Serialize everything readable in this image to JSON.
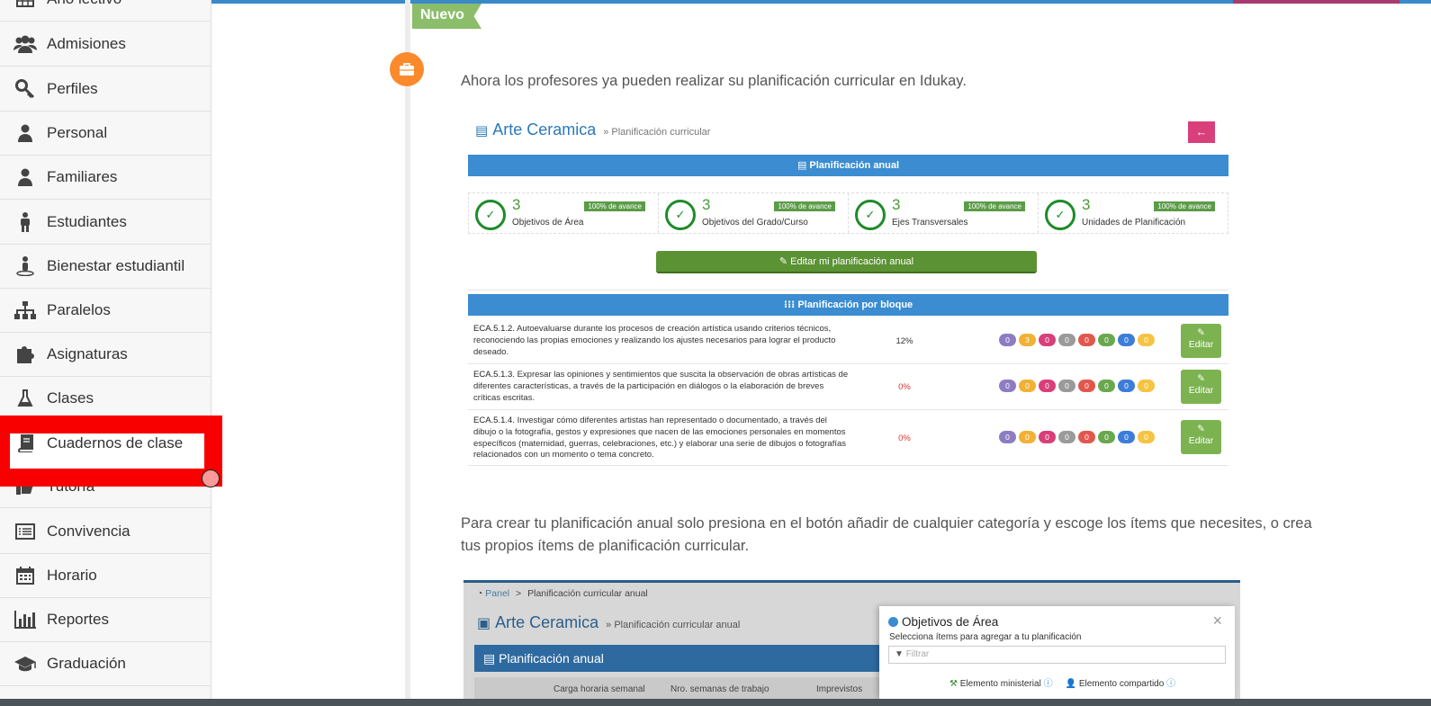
{
  "sidebar": {
    "items": [
      {
        "label": "Año lectivo",
        "icon": "calendar-grid-icon"
      },
      {
        "label": "Admisiones",
        "icon": "users-icon"
      },
      {
        "label": "Perfiles",
        "icon": "key-icon"
      },
      {
        "label": "Personal",
        "icon": "user-icon"
      },
      {
        "label": "Familiares",
        "icon": "user-icon"
      },
      {
        "label": "Estudiantes",
        "icon": "child-icon"
      },
      {
        "label": "Bienestar estudiantil",
        "icon": "person-pin-icon"
      },
      {
        "label": "Paralelos",
        "icon": "sitemap-icon"
      },
      {
        "label": "Asignaturas",
        "icon": "puzzle-icon"
      },
      {
        "label": "Clases",
        "icon": "flask-icon"
      },
      {
        "label": "Cuadernos de clase",
        "icon": "book-icon"
      },
      {
        "label": "Tutoría",
        "icon": "thumbs-up-icon"
      },
      {
        "label": "Convivencia",
        "icon": "list-alt-icon"
      },
      {
        "label": "Horario",
        "icon": "calendar-icon"
      },
      {
        "label": "Reportes",
        "icon": "bar-chart-icon"
      },
      {
        "label": "Graduación",
        "icon": "graduation-cap-icon"
      }
    ]
  },
  "timeline": {
    "tag": "Nuevo",
    "icon": "briefcase-icon",
    "intro": "Ahora los profesores ya pueden realizar su planificación curricular en Idukay.",
    "outro": "Para crear tu planificación anual solo presiona en el botón añadir de cualquier categoría y escoge los ítems que necesites, o crea tus propios ítems de planificación curricular."
  },
  "card1": {
    "title": "Arte Ceramica",
    "subtitle": "» Planificación curricular",
    "annual_bar": "Planificación anual",
    "stats": [
      {
        "num": "3",
        "name": "Objetivos de Área",
        "badge": "100% de avance"
      },
      {
        "num": "3",
        "name": "Objetivos del Grado/Curso",
        "badge": "100% de avance"
      },
      {
        "num": "3",
        "name": "Ejes Transversales",
        "badge": "100% de avance"
      },
      {
        "num": "3",
        "name": "Unidades de Planificación",
        "badge": "100% de avance"
      }
    ],
    "edit_annual": "Editar mi planificación anual",
    "block_bar": "Planificación por bloque",
    "edit_label": "Editar",
    "rows": [
      {
        "code": "ECA.5.1.2.",
        "text": "Autoevaluarse durante los procesos de creación artística usando criterios técnicos, reconociendo las propias emociones y realizando los ajustes necesarios para lograr el producto deseado.",
        "pct": "12%",
        "pills": [
          "0",
          "3",
          "0",
          "0",
          "0",
          "0",
          "0",
          "0"
        ]
      },
      {
        "code": "ECA.5.1.3.",
        "text": "Expresar las opiniones y sentimientos que suscita la observación de obras artísticas de diferentes características, a través de la participación en diálogos o la elaboración de breves críticas escritas.",
        "pct": "0%",
        "pills": [
          "0",
          "0",
          "0",
          "0",
          "0",
          "0",
          "0",
          "0"
        ]
      },
      {
        "code": "ECA.5.1.4.",
        "text": "Investigar cómo diferentes artistas han representado o documentado, a través del dibujo o la fotografía, gestos y expresiones que nacen de las emociones personales en momentos específicos (maternidad, guerras, celebraciones, etc.) y elaborar una serie de dibujos o fotografías relacionados con un momento o tema concreto.",
        "pct": "0%",
        "pills": [
          "0",
          "0",
          "0",
          "0",
          "0",
          "0",
          "0",
          "0"
        ]
      }
    ],
    "pill_colors": [
      "#8e7cc3",
      "#f2b134",
      "#d93f7a",
      "#9a9a9a",
      "#e2574c",
      "#6aa84f",
      "#3b7dd8",
      "#f6c343"
    ]
  },
  "card2": {
    "crumb_home": "Panel",
    "crumb_sep": ">",
    "crumb_page": "Planificación curricular anual",
    "title": "Arte Ceramica",
    "subtitle": "» Planificación curricular anual",
    "bar": "Planificación anual",
    "col1": "Carga horaria semanal",
    "col2": "Nro. semanas de trabajo",
    "col3": "Imprevistos",
    "modal": {
      "title": "Objetivos de Área",
      "subtitle": "Selecciona ítems para agregar a tu planificación",
      "filter_placeholder": "Filtrar",
      "legend_ministerial": "Elemento ministerial",
      "legend_shared": "Elemento compartido"
    }
  },
  "colors": {
    "accent": "#3b8cd1",
    "highlight": "#f80000",
    "green": "#5b9233",
    "pink": "#d93f7a",
    "orange": "#fb8a2c"
  }
}
